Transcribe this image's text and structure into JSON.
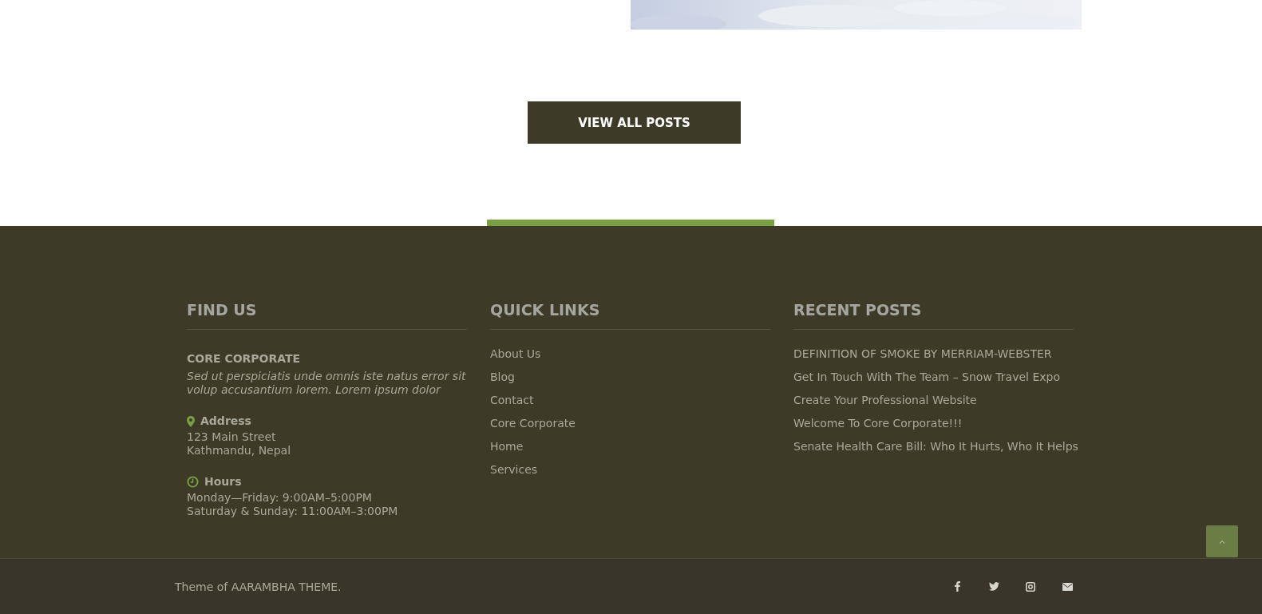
{
  "view_all_button": "VIEW ALL POSTS",
  "footer": {
    "find_us": {
      "title": "FIND US",
      "company": "CORE CORPORATE",
      "description": "Sed ut perspiciatis unde omnis iste natus error sit volup accusantium lorem. Lorem ipsum dolor",
      "blocks": [
        {
          "kind": "address",
          "label": "Address",
          "lines": [
            "123 Main Street",
            "Kathmandu, Nepal"
          ]
        },
        {
          "kind": "hours",
          "label": "Hours",
          "lines": [
            "Monday—Friday: 9:00AM–5:00PM",
            "Saturday & Sunday: 11:00AM–3:00PM"
          ]
        }
      ]
    },
    "quick_links": {
      "title": "QUICK LINKS",
      "items": [
        "About Us",
        "Blog",
        "Contact",
        "Core Corporate",
        "Home",
        "Services"
      ]
    },
    "recent_posts": {
      "title": "RECENT POSTS",
      "items": [
        "DEFINITION OF SMOKE BY MERRIAM-WEBSTER",
        "Get In Touch With The Team – Snow Travel Expo",
        "Create Your Professional Website",
        "Welcome To Core Corporate!!!",
        "Senate Health Care Bill: Who It Hurts, Who It Helps"
      ]
    }
  },
  "bottom_bar": {
    "credit": "Theme of AARAMBHA THEME.",
    "social": [
      {
        "kind": "facebook"
      },
      {
        "kind": "twitter"
      },
      {
        "kind": "instagram"
      },
      {
        "kind": "email"
      }
    ]
  }
}
